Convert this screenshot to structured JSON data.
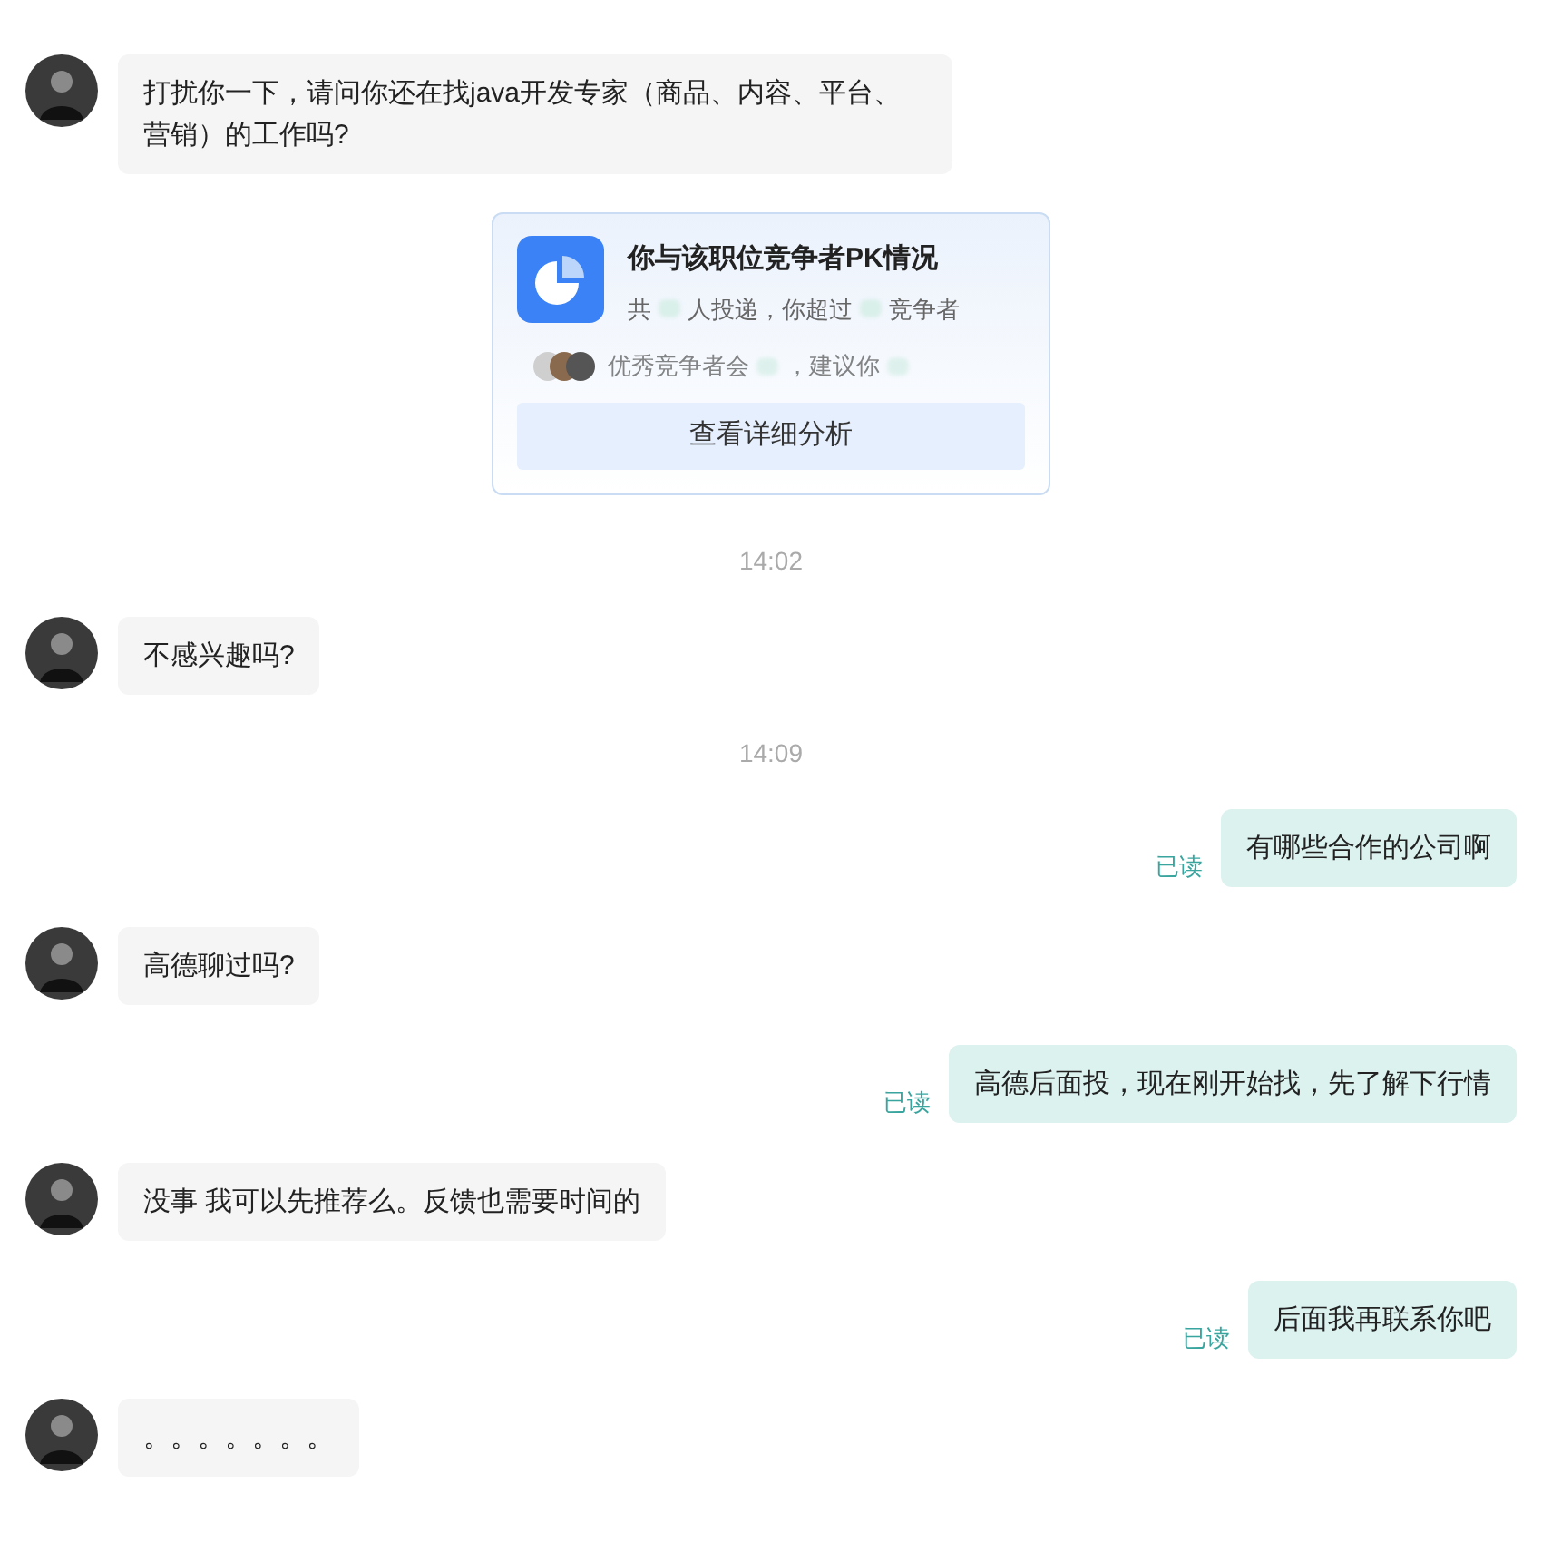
{
  "messages": [
    {
      "kind": "incoming",
      "text": "打扰你一下，请问你还在找java开发专家（商品、内容、平台、营销）的工作吗?"
    },
    {
      "kind": "card",
      "title": "你与该职位竞争者PK情况",
      "summary": [
        {
          "kind": "text",
          "text": "共"
        },
        {
          "kind": "blurred"
        },
        {
          "kind": "text",
          "text": "人投递，你超过"
        },
        {
          "kind": "blurred"
        },
        {
          "kind": "text",
          "text": "竞争者"
        }
      ],
      "tip": [
        {
          "kind": "text",
          "text": "优秀竞争者会"
        },
        {
          "kind": "blurred"
        },
        {
          "kind": "text",
          "text": "，建议你"
        },
        {
          "kind": "blurred"
        }
      ],
      "button": "查看详细分析"
    },
    {
      "kind": "time",
      "text": "14:02"
    },
    {
      "kind": "incoming",
      "text": "不感兴趣吗?"
    },
    {
      "kind": "time",
      "text": "14:09"
    },
    {
      "kind": "outgoing",
      "text": "有哪些合作的公司啊",
      "status": "已读"
    },
    {
      "kind": "incoming",
      "text": "高德聊过吗?"
    },
    {
      "kind": "outgoing",
      "text": "高德后面投，现在刚开始找，先了解下行情",
      "status": "已读"
    },
    {
      "kind": "incoming",
      "text": "没事 我可以先推荐么。反馈也需要时间的"
    },
    {
      "kind": "outgoing",
      "text": "后面我再联系你吧",
      "status": "已读"
    },
    {
      "kind": "incoming",
      "text": "。。。。。。。"
    }
  ]
}
